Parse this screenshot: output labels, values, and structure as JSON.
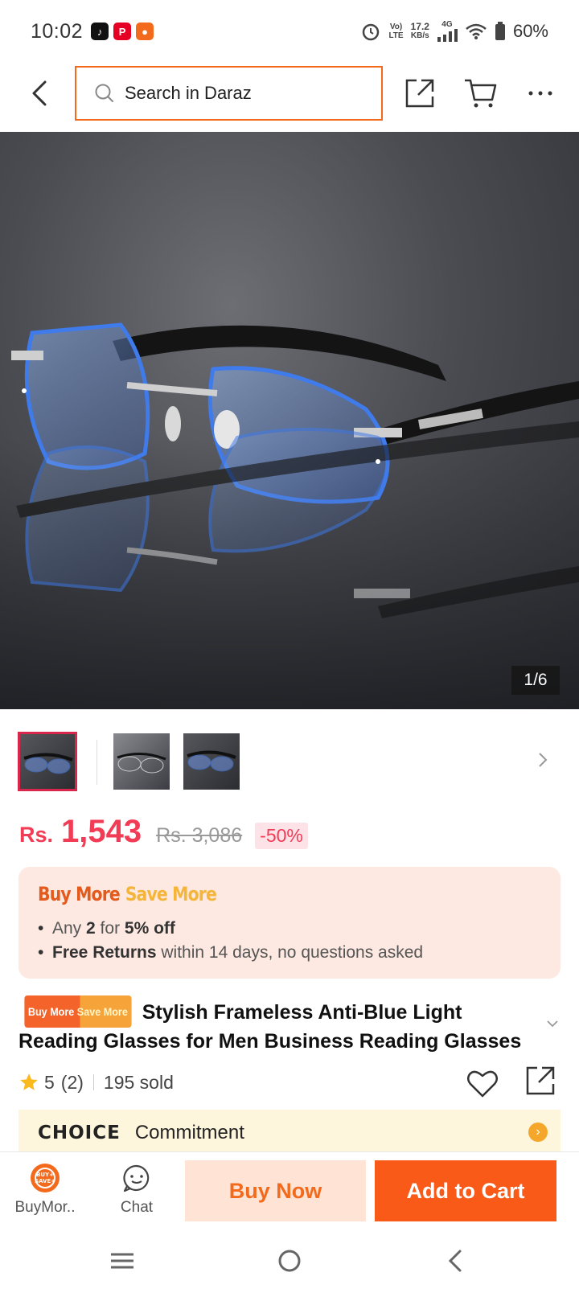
{
  "status_bar": {
    "time": "10:02",
    "net_top": "Vo)",
    "net_bottom": "LTE",
    "speed_top": "17.2",
    "speed_bottom": "KB/s",
    "network": "4G",
    "battery": "60%"
  },
  "header": {
    "search_placeholder": "Search in Daraz",
    "icons": [
      "back-icon",
      "search-icon",
      "share-icon",
      "cart-icon",
      "more-icon"
    ]
  },
  "gallery": {
    "counter": "1/6",
    "thumbnail_count": 3
  },
  "price": {
    "currency": "Rs.",
    "current": "1,543",
    "original": "Rs. 3,086",
    "discount": "-50%"
  },
  "promo": {
    "title_part1": "Buy More",
    "title_part2": "Save More",
    "line1_prefix": "Any ",
    "line1_qty": "2",
    "line1_mid": " for ",
    "line1_off": "5% off",
    "line2_bold": "Free Returns",
    "line2_rest": " within 14 days, no questions asked"
  },
  "product": {
    "badge_part1": "Buy More",
    "badge_part2": "Save More",
    "title": "Stylish Frameless Anti-Blue Light Reading Glasses for Men Business Reading Glasses",
    "rating": "5",
    "reviews": "(2)",
    "sold": "195 sold"
  },
  "choice": {
    "logo": "CHOICE",
    "text": "Commitment"
  },
  "bottom_bar": {
    "buymore_label": "BuyMor..",
    "chat_label": "Chat",
    "buy_now": "Buy Now",
    "add_to_cart": "Add to Cart"
  },
  "colors": {
    "accent": "#f36a1c",
    "price": "#f23c56",
    "add_to_cart_bg": "#fa5a17",
    "buy_now_bg": "#ffe4d6"
  }
}
